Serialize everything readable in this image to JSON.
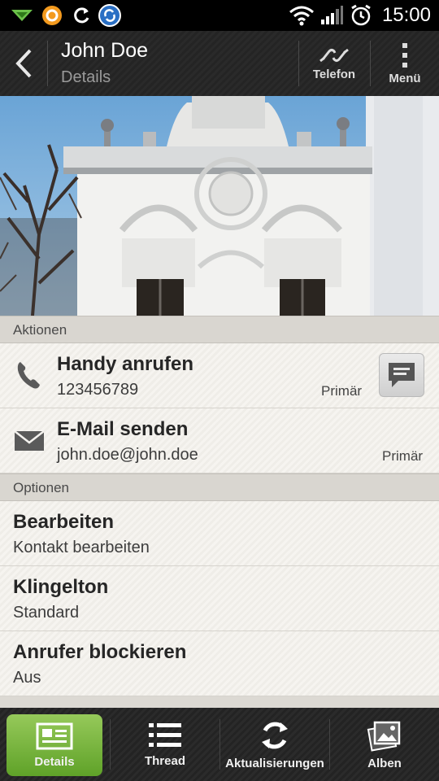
{
  "status_bar": {
    "time": "15:00",
    "icons": [
      "download-arrow-icon",
      "orange-app-icon",
      "sync-icon",
      "blue-app-icon",
      "wifi-icon",
      "signal-icon",
      "alarm-clock-icon"
    ]
  },
  "action_bar": {
    "title": "John Doe",
    "subtitle": "Details",
    "telefon_label": "Telefon",
    "menu_label": "Menü",
    "icons": [
      "back-chevron-icon",
      "link-icon",
      "overflow-menu-icon"
    ]
  },
  "sections": {
    "actions_header": "Aktionen",
    "options_header": "Optionen"
  },
  "actions": [
    {
      "title": "Handy anrufen",
      "value": "123456789",
      "tag": "Primär",
      "icon": "phone-icon"
    },
    {
      "title": "E-Mail senden",
      "value": "john.doe@john.doe",
      "tag": "Primär",
      "icon": "envelope-icon"
    }
  ],
  "options": [
    {
      "title": "Bearbeiten",
      "value": "Kontakt bearbeiten"
    },
    {
      "title": "Klingelton",
      "value": "Standard"
    },
    {
      "title": "Anrufer blockieren",
      "value": "Aus"
    }
  ],
  "tabs": [
    {
      "label": "Details",
      "icon": "contact-card-icon",
      "active": true
    },
    {
      "label": "Thread",
      "icon": "list-icon",
      "active": false
    },
    {
      "label": "Aktualisierungen",
      "icon": "refresh-icon",
      "active": false
    },
    {
      "label": "Alben",
      "icon": "photo-album-icon",
      "active": false
    }
  ],
  "colors": {
    "accent_green": "#6fb035",
    "bar_dark": "#262626",
    "section_header": "#d9d6d0"
  }
}
